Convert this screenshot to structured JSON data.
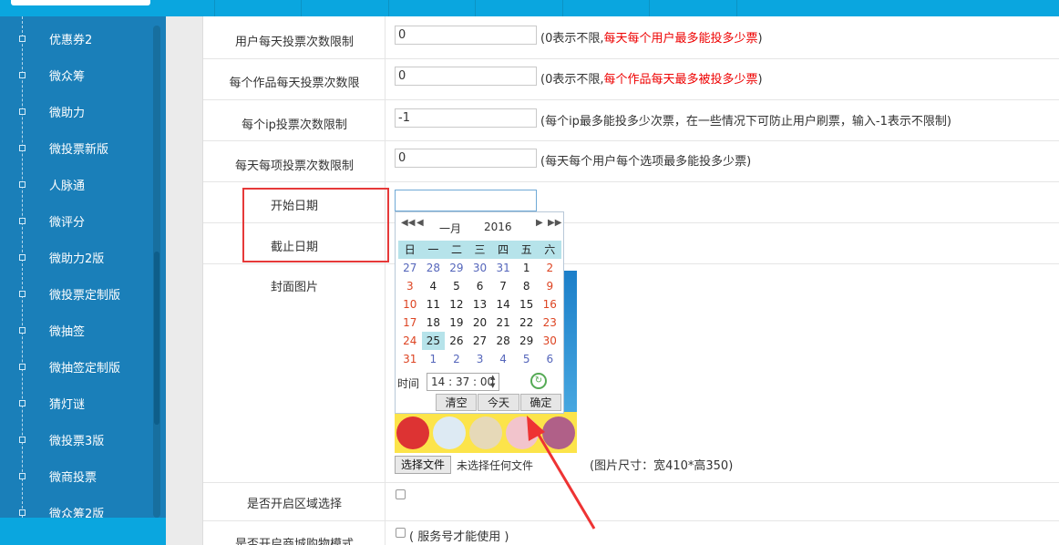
{
  "sidebar": {
    "items": [
      {
        "label": "优惠券2"
      },
      {
        "label": "微众筹"
      },
      {
        "label": "微助力"
      },
      {
        "label": "微投票新版"
      },
      {
        "label": "人脉通"
      },
      {
        "label": "微评分"
      },
      {
        "label": "微助力2版"
      },
      {
        "label": "微投票定制版"
      },
      {
        "label": "微抽签"
      },
      {
        "label": "微抽签定制版"
      },
      {
        "label": "猜灯谜"
      },
      {
        "label": "微投票3版"
      },
      {
        "label": "微商投票"
      },
      {
        "label": "微众筹2版"
      }
    ]
  },
  "form": {
    "user_daily_limit": {
      "label": "用户每天投票次数限制",
      "value": "0",
      "hint_plain": "(0表示不限,",
      "hint_red": "每天每个用户最多能投多少票",
      "hint_end": ")"
    },
    "work_daily_limit": {
      "label": "每个作品每天投票次数限",
      "value": "0",
      "hint_plain": "(0表示不限,",
      "hint_red": "每个作品每天最多被投多少票",
      "hint_end": ")"
    },
    "ip_limit": {
      "label": "每个ip投票次数限制",
      "value": "-1",
      "hint_red": "(每个ip最多能投多少次票，在一些情况下可防止用户刷票，输入-1表示不限制)"
    },
    "item_daily_limit": {
      "label": "每天每项投票次数限制",
      "value": "0",
      "hint_red": "(每天每个用户每个选项最多能投多少票)"
    },
    "start_date": {
      "label": "开始日期",
      "value": ""
    },
    "end_date": {
      "label": "截止日期"
    },
    "cover": {
      "label": "封面图片",
      "file_button": "选择文件",
      "file_status": "未选择任何文件",
      "size_hint": "(图片尺寸：宽410*高350)"
    },
    "region": {
      "label": "是否开启区域选择"
    },
    "mall": {
      "label": "是否开启商城购物模式",
      "hint_red": "( 服务号才能使用 )"
    }
  },
  "calendar": {
    "nav_prev_year": "◀◀",
    "nav_prev_month": "◀",
    "nav_next_month": "▶",
    "nav_next_year": "▶▶",
    "month": "一月",
    "year": "2016",
    "weekdays": [
      "日",
      "一",
      "二",
      "三",
      "四",
      "五",
      "六"
    ],
    "weeks": [
      [
        "27",
        "28",
        "29",
        "30",
        "31",
        "1",
        "2"
      ],
      [
        "3",
        "4",
        "5",
        "6",
        "7",
        "8",
        "9"
      ],
      [
        "10",
        "11",
        "12",
        "13",
        "14",
        "15",
        "16"
      ],
      [
        "17",
        "18",
        "19",
        "20",
        "21",
        "22",
        "23"
      ],
      [
        "24",
        "25",
        "26",
        "27",
        "28",
        "29",
        "30"
      ],
      [
        "31",
        "1",
        "2",
        "3",
        "4",
        "5",
        "6"
      ]
    ],
    "selected_day": "25",
    "time_label": "时间",
    "time_value": "14 : 37 : 00",
    "spin_up": "▲",
    "spin_down": "▼",
    "refresh_glyph": "↻",
    "clear_label": "清空",
    "today_label": "今天",
    "ok_label": "确定"
  },
  "colors": {
    "topbar": "#0aa6df",
    "sidebar": "#1a7fb9",
    "hint_red": "#ee0000",
    "highlight_box": "#e63939",
    "calendar_header": "#b6e3ea"
  }
}
